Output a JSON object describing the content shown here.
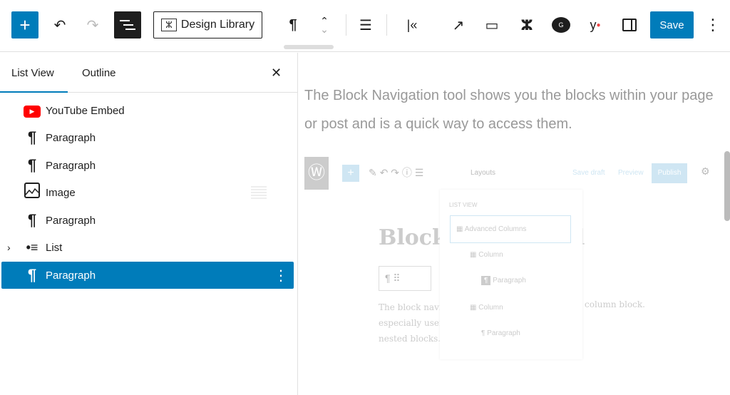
{
  "toolbar": {
    "add_label": "+",
    "design_library_label": "Design Library",
    "save_label": "Save",
    "paragraph_icon": "¶"
  },
  "panel": {
    "tabs": [
      {
        "label": "List View",
        "active": true
      },
      {
        "label": "Outline",
        "active": false
      }
    ],
    "close": "✕",
    "items": [
      {
        "label": "YouTube Embed",
        "icon": "youtube-icon"
      },
      {
        "label": "Paragraph",
        "icon": "paragraph-icon"
      },
      {
        "label": "Paragraph",
        "icon": "paragraph-icon"
      },
      {
        "label": "Image",
        "icon": "image-icon"
      },
      {
        "label": "Paragraph",
        "icon": "paragraph-icon"
      },
      {
        "label": "List",
        "icon": "list-icon",
        "expandable": true
      },
      {
        "label": "Paragraph",
        "icon": "paragraph-icon",
        "selected": true
      }
    ]
  },
  "content": {
    "intro": "The Block Navigation tool shows you the blocks within your page or post and is a quick way to access them.",
    "embedded": {
      "layouts": "Layouts",
      "save_draft": "Save draft",
      "preview": "Preview",
      "publish": "Publish",
      "heading_left": "Block",
      "heading_right": "ool",
      "list_view_title": "LIST VIEW",
      "tree": [
        "Advanced Columns",
        "Column",
        "Paragraph",
        "Column",
        "Paragraph"
      ],
      "body_left": [
        "The block navi",
        "especially usef",
        "nested blocks."
      ],
      "body_right": "column block."
    }
  },
  "colors": {
    "accent": "#007cba",
    "youtube": "#ff0000"
  }
}
